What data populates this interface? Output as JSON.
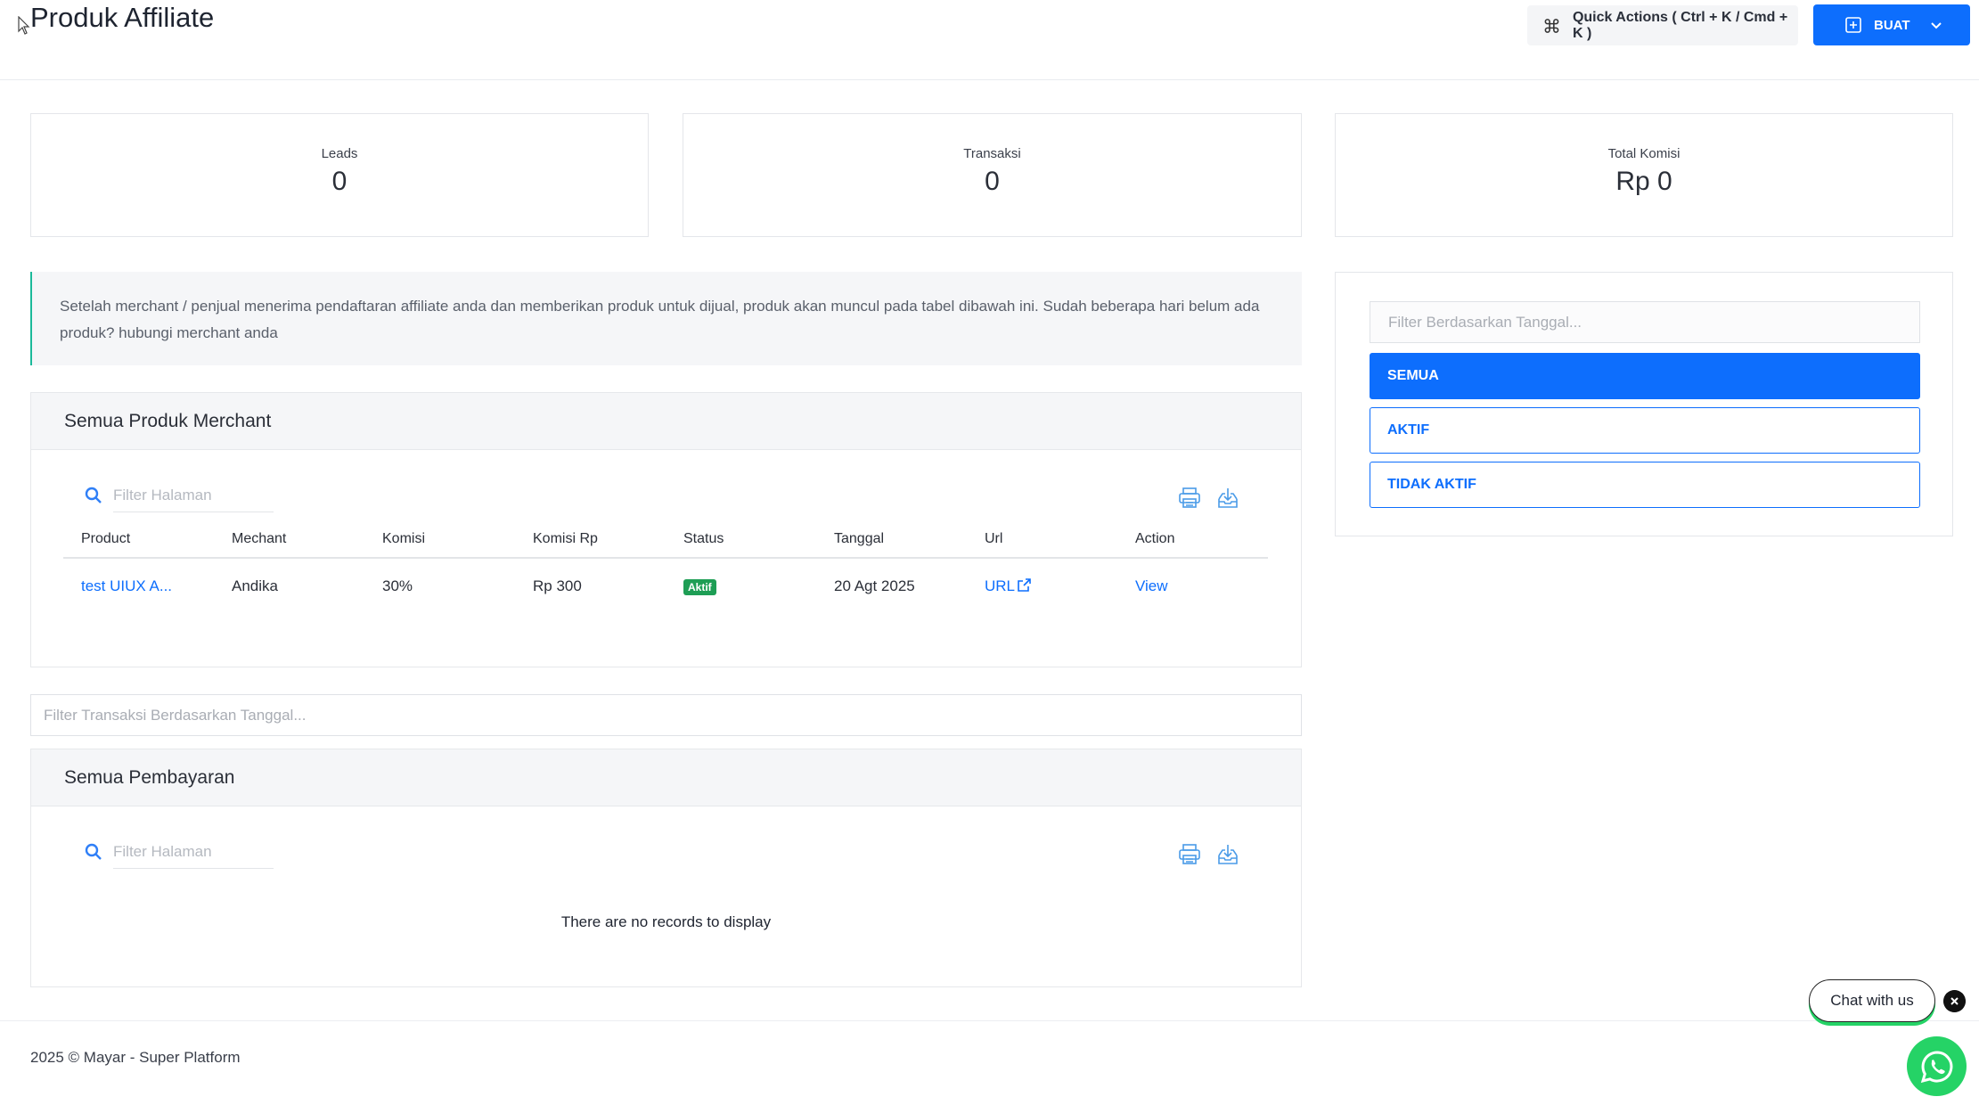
{
  "header": {
    "title": "Produk Affiliate",
    "quick_actions_label": "Quick Actions ( Ctrl + K / Cmd + K )",
    "create_label": "BUAT"
  },
  "stats": [
    {
      "label": "Leads",
      "value": "0"
    },
    {
      "label": "Transaksi",
      "value": "0"
    },
    {
      "label": "Total Komisi",
      "value": "Rp 0"
    }
  ],
  "info_note": "Setelah merchant / penjual menerima pendaftaran affiliate anda dan memberikan produk untuk dijual, produk akan muncul pada tabel dibawah ini. Sudah beberapa hari belum ada produk? hubungi merchant anda",
  "products_panel": {
    "title": "Semua Produk Merchant",
    "search_placeholder": "Filter Halaman",
    "columns": [
      "Product",
      "Mechant",
      "Komisi",
      "Komisi Rp",
      "Status",
      "Tanggal",
      "Url",
      "Action"
    ],
    "rows": [
      {
        "product": "test UIUX A...",
        "merchant": "Andika",
        "komisi": "30%",
        "komisi_rp": "Rp 300",
        "status": "Aktif",
        "tanggal": "20 Agt 2025",
        "url": "URL",
        "action": "View"
      }
    ]
  },
  "transaction_date_filter_placeholder": "Filter Transaksi Berdasarkan Tanggal...",
  "payments_panel": {
    "title": "Semua Pembayaran",
    "search_placeholder": "Filter Halaman",
    "empty_message": "There are no records to display"
  },
  "right_filter": {
    "date_placeholder": "Filter Berdasarkan Tanggal...",
    "options": [
      "SEMUA",
      "AKTIF",
      "TIDAK AKTIF"
    ],
    "selected": "SEMUA"
  },
  "footer": {
    "text": "2025 © Mayar - Super Platform"
  },
  "chat": {
    "label": "Chat with us"
  },
  "colors": {
    "primary": "#0d6efd",
    "success_badge": "#1e9e55",
    "info_border": "#1bb99a",
    "whatsapp": "#25d366"
  }
}
